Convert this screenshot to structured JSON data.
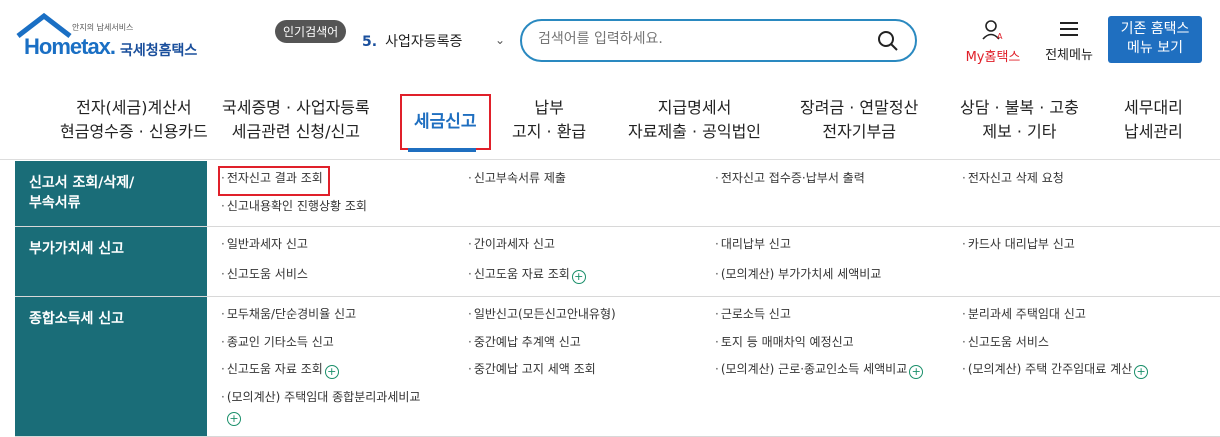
{
  "header": {
    "logo_sub": "안지의 납세서비스",
    "logo_text": "Hometax.",
    "logo_korean": "국세청홈택스",
    "popular_badge": "인기검색어",
    "rank_number": "5.",
    "rank_term": "사업자등록증",
    "search_placeholder": "검색어를 입력하세요.",
    "my_label": "My홈택스",
    "all_menu_label": "전체메뉴",
    "old_hometax_line1": "기존 홈택스",
    "old_hometax_line2": "메뉴 보기"
  },
  "gnb": [
    {
      "l1": "전자(세금)계산서",
      "l2": "현금영수증 · 신용카드"
    },
    {
      "l1": "국세증명 · 사업자등록",
      "l2": "세금관련 신청/신고"
    },
    {
      "l1": "세금신고"
    },
    {
      "l1": "납부",
      "l2": "고지 · 환급"
    },
    {
      "l1": "지급명세서",
      "l2": "자료제출 · 공익법인"
    },
    {
      "l1": "장려금 · 연말정산",
      "l2": "전자기부금"
    },
    {
      "l1": "상담 · 불복 · 고충",
      "l2": "제보 · 기타"
    },
    {
      "l1": "세무대리",
      "l2": "납세관리"
    }
  ],
  "sections": [
    {
      "title1": "신고서 조회/삭제/",
      "title2": "부속서류",
      "items": [
        "전자신고 결과 조회",
        "신고부속서류 제출",
        "전자신고 접수증·납부서 출력",
        "전자신고 삭제 요청",
        "신고내용확인 진행상황 조회"
      ]
    },
    {
      "title1": "부가가치세 신고",
      "items": [
        "일반과세자 신고",
        "간이과세자 신고",
        "대리납부 신고",
        "카드사 대리납부 신고",
        "신고도움 서비스",
        "신고도움 자료 조회",
        "(모의계산) 부가가치세 세액비교"
      ]
    },
    {
      "title1": "종합소득세 신고",
      "items": [
        "모두채움/단순경비율 신고",
        "일반신고(모든신고안내유형)",
        "근로소득 신고",
        "분리과세 주택임대 신고",
        "종교인 기타소득 신고",
        "중간예납 추계액 신고",
        "토지 등 매매차익 예정신고",
        "신고도움 서비스",
        "신고도움 자료 조회",
        "중간예납 고지 세액 조회",
        "(모의계산) 근로·종교인소득 세액비교",
        "(모의계산) 주택 간주임대료 계산",
        "(모의계산) 주택임대 종합분리과세비교"
      ]
    }
  ],
  "colors": {
    "brand": "#1f6fc0",
    "section_bg": "#1a6d78",
    "highlight": "#e0202a"
  }
}
